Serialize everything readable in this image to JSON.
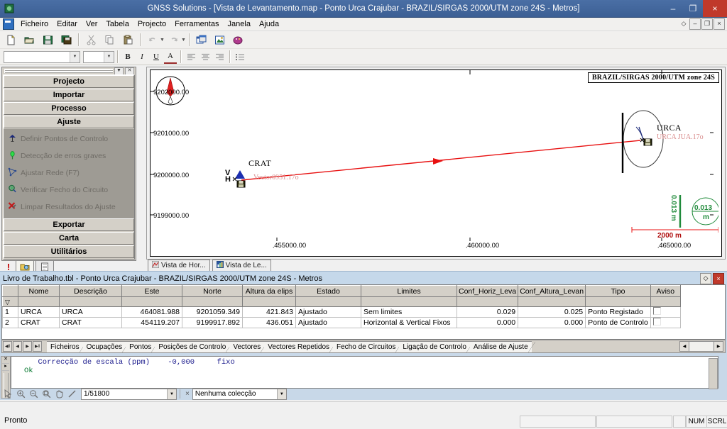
{
  "window": {
    "title": "GNSS Solutions - [Vista de Levantamento.map - Ponto Urca Crajubar - BRAZIL/SIRGAS 2000/UTM zone 24S  - Metros]",
    "app_icon": "gnss-app-icon",
    "minimize": "–",
    "maximize": "❐",
    "close": "×"
  },
  "menu": {
    "mdi_icon": "document-icon",
    "items": [
      "Ficheiro",
      "Editar",
      "Ver",
      "Tabela",
      "Projecto",
      "Ferramentas",
      "Janela",
      "Ajuda"
    ],
    "mdi_controls": [
      "◇",
      "–",
      "❐",
      "×"
    ]
  },
  "toolbar": {
    "buttons": [
      {
        "name": "new-icon",
        "glyph": "new"
      },
      {
        "name": "open-icon",
        "glyph": "open"
      },
      {
        "name": "save-icon",
        "glyph": "save"
      },
      {
        "name": "save-all-icon",
        "glyph": "saveall"
      },
      {
        "name": "cut-icon",
        "glyph": "cut"
      },
      {
        "name": "copy-icon",
        "glyph": "copy"
      },
      {
        "name": "paste-icon",
        "glyph": "paste"
      },
      {
        "name": "undo-icon",
        "glyph": "undo"
      },
      {
        "name": "redo-icon",
        "glyph": "redo"
      },
      {
        "name": "window-view-icon",
        "glyph": "winview"
      },
      {
        "name": "map-view-icon",
        "glyph": "mapview"
      },
      {
        "name": "palette-icon",
        "glyph": "palette"
      }
    ]
  },
  "format_toolbar": {
    "font_name": "",
    "font_size": "",
    "bold": "B",
    "italic": "I",
    "underline": "U",
    "font_color": "A",
    "align_left": "align-left",
    "align_center": "align-center",
    "align_right": "align-right",
    "bullets": "bullets"
  },
  "sidebar": {
    "headers_top": [
      "Projecto",
      "Importar",
      "Processo",
      "Ajuste"
    ],
    "active_header": "Ajuste",
    "items": [
      {
        "label": "Definir Pontos de Controlo",
        "icon": "control-point-icon"
      },
      {
        "label": "Detecção de erros graves",
        "icon": "blunder-detect-icon"
      },
      {
        "label": "Ajustar Rede (F7)",
        "icon": "adjust-network-icon"
      },
      {
        "label": "Verificar Fecho do Circuito",
        "icon": "loop-closure-icon"
      },
      {
        "label": "Limpar Resultados do Ajuste",
        "icon": "clear-results-icon"
      }
    ],
    "headers_bottom": [
      "Exportar",
      "Carta",
      "Utilitários"
    ],
    "tabs": [
      {
        "name": "project-tab",
        "icon": "project-icon"
      },
      {
        "name": "report-tab",
        "icon": "report-icon"
      }
    ],
    "alert_icon": "exclamation-icon"
  },
  "map": {
    "crs_label": "BRAZIL/SIRGAS 2000/UTM zone 24S",
    "compass": "north-arrow",
    "y_ticks": [
      "9202000.00",
      "9201000.00",
      "9200000.00",
      "9199000.00"
    ],
    "x_ticks": [
      "455000.00",
      "460000.00",
      "465000.00"
    ],
    "points": [
      {
        "name": "CRAT",
        "sublabel": "Vector0951.17o",
        "type": "control-point"
      },
      {
        "name": "URCA",
        "sublabel": "URCA JUA.17o",
        "type": "registered-point"
      }
    ],
    "v_label": "V",
    "h_label": "H",
    "error_ellipse_value": "0.013",
    "error_ellipse_unit": "m",
    "error_bar_value": "0.013 m",
    "scale_bar": "2000 m",
    "tabs": [
      {
        "label": "Vista de Hor...",
        "icon": "horizontal-view-icon"
      },
      {
        "label": "Vista de Le...",
        "icon": "survey-view-icon"
      }
    ]
  },
  "workbook": {
    "title": "Livro de Trabalho.tbl - Ponto Urca Crajubar - BRAZIL/SIRGAS 2000/UTM zone 24S  - Metros",
    "controls": [
      "◇",
      "×"
    ],
    "columns": [
      "Nome",
      "Descrição",
      "Este",
      "Norte",
      "Altura da elips",
      "Estado",
      "Limites",
      "Conf_Horiz_Leva",
      "Conf_Altura_Levan",
      "Tipo",
      "Aviso"
    ],
    "rows": [
      {
        "index": "1",
        "Nome": "URCA",
        "Descricao": "URCA",
        "Este": "464081.988",
        "Norte": "9201059.349",
        "Altura": "421.843",
        "Estado": "Ajustado",
        "Limites": "Sem limites",
        "ConfHoriz": "0.029",
        "ConfAltura": "0.025",
        "Tipo": "Ponto Registado",
        "Aviso": ""
      },
      {
        "index": "2",
        "Nome": "CRAT",
        "Descricao": "CRAT",
        "Este": "454119.207",
        "Norte": "9199917.892",
        "Altura": "436.051",
        "Estado": "Ajustado",
        "Limites": "Horizontal & Vertical Fixos",
        "ConfHoriz": "0.000",
        "ConfAltura": "0.000",
        "Tipo": "Ponto de Controlo",
        "Aviso": ""
      }
    ],
    "filter_icon": "filter-funnel-icon",
    "sheet_tabs": [
      "Ficheiros",
      "Ocupações",
      "Pontos",
      "Posições de Controlo",
      "Vectores",
      "Vectores Repetidos",
      "Fecho de Circuitos",
      "Ligação de Controlo",
      "Análise de Ajuste"
    ],
    "nav_buttons": [
      "◀‖",
      "◀",
      "▶",
      "▶‖"
    ]
  },
  "console": {
    "lines": [
      {
        "text": "     Correcção de escala (ppm)    -0,000     fixo",
        "style": "info"
      },
      {
        "text": "Ok",
        "style": "ok"
      }
    ],
    "toolbar": {
      "tools": [
        {
          "name": "select-arrow-icon"
        },
        {
          "name": "zoom-in-icon"
        },
        {
          "name": "zoom-out-icon"
        },
        {
          "name": "zoom-extent-icon"
        },
        {
          "name": "pan-hand-icon"
        },
        {
          "name": "measure-icon"
        }
      ],
      "scale_value": "1/51800",
      "collection_close": "×",
      "collection_value": "Nenhuma colecção"
    }
  },
  "statusbar": {
    "ready": "Pronto",
    "num": "NUM",
    "scrl": "SCRL"
  }
}
